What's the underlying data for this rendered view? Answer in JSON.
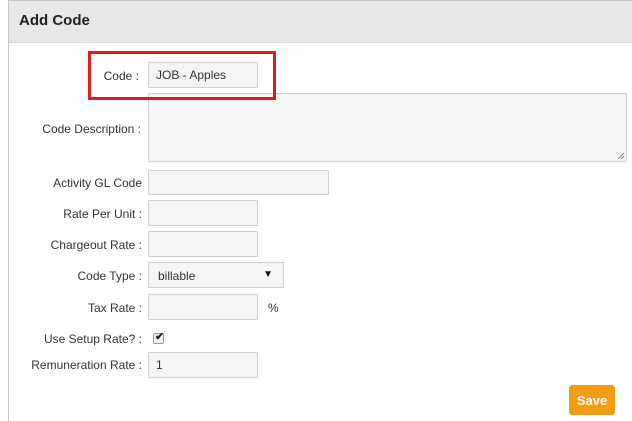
{
  "panel": {
    "title": "Add Code"
  },
  "form": {
    "code": {
      "label": "Code :",
      "value": "JOB - Apples"
    },
    "code_description": {
      "label": "Code Description :",
      "value": ""
    },
    "activity_gl_code": {
      "label": "Activity GL Code",
      "value": ""
    },
    "rate_per_unit": {
      "label": "Rate Per Unit :",
      "value": ""
    },
    "chargeout_rate": {
      "label": "Chargeout Rate :",
      "value": ""
    },
    "code_type": {
      "label": "Code Type :",
      "value": "billable",
      "arrow": "▼"
    },
    "tax_rate": {
      "label": "Tax Rate :",
      "value": "",
      "suffix": "%"
    },
    "use_setup_rate": {
      "label": "Use Setup Rate? :",
      "checked": true,
      "check_glyph": "✔"
    },
    "remuneration_rate": {
      "label": "Remuneration Rate :",
      "value": "1"
    },
    "save_label": "Save"
  },
  "annotation": {
    "highlight_color": "#e11b1b"
  },
  "colors": {
    "accent": "#f39c12",
    "header_bg": "#e8e8e8",
    "field_bg": "#f5f5f5"
  }
}
